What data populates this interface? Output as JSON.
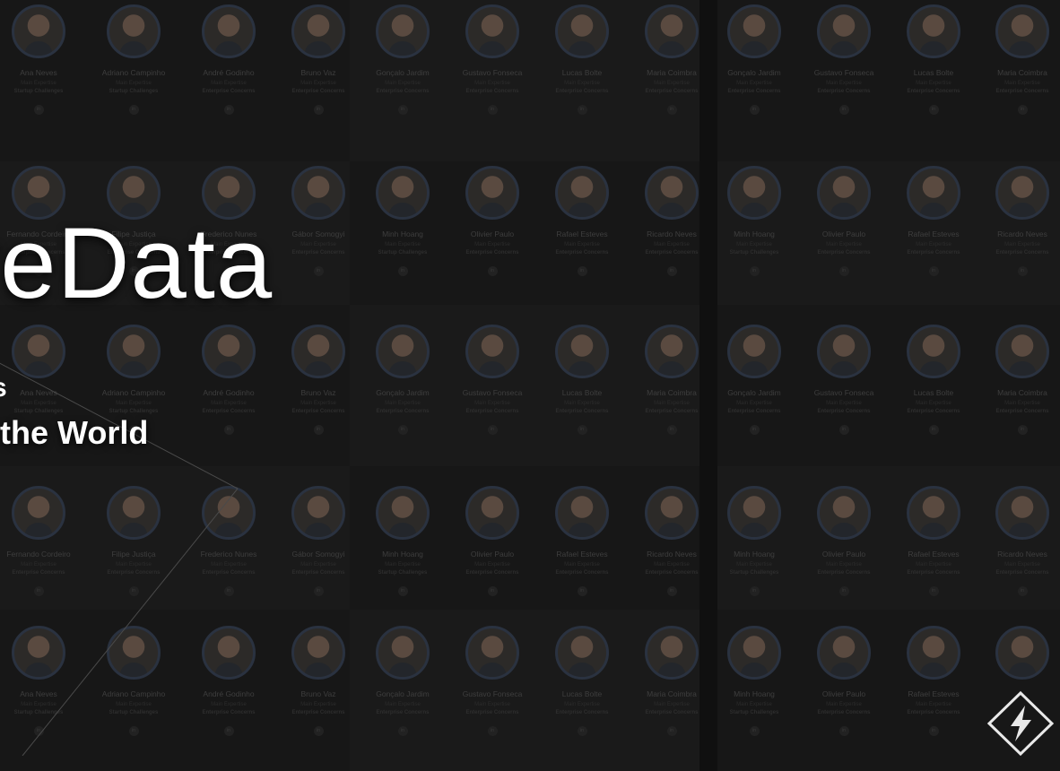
{
  "hero": {
    "title_fragment": "reData",
    "tagline_fragment_1": "s",
    "tagline_fragment_2": "the World"
  },
  "people_grid": [
    [
      {
        "name": "Ana Neves",
        "meta": "Main Expertise",
        "expertise": "Startup Challenges"
      },
      {
        "name": "Adriano Campinho",
        "meta": "Main Expertise",
        "expertise": "Startup Challenges"
      },
      {
        "name": "André Godinho",
        "meta": "Main Expertise",
        "expertise": "Enterprise Concerns"
      },
      {
        "name": "Bruno Vaz",
        "meta": "Main Expertise",
        "expertise": "Enterprise Concerns"
      },
      {
        "name": "Gonçalo Jardim",
        "meta": "Main Expertise",
        "expertise": "Enterprise Concerns"
      },
      {
        "name": "Gustavo Fonseca",
        "meta": "Main Expertise",
        "expertise": "Enterprise Concerns"
      },
      {
        "name": "Lucas Bolte",
        "meta": "Main Expertise",
        "expertise": "Enterprise Concerns"
      },
      {
        "name": "Maria Coimbra",
        "meta": "Main Expertise",
        "expertise": "Enterprise Concerns"
      },
      {
        "name": "Gonçalo Jardim",
        "meta": "Main Expertise",
        "expertise": "Enterprise Concerns"
      },
      {
        "name": "Gustavo Fonseca",
        "meta": "Main Expertise",
        "expertise": "Enterprise Concerns"
      },
      {
        "name": "Lucas Bolte",
        "meta": "Main Expertise",
        "expertise": "Enterprise Concerns"
      },
      {
        "name": "Maria Coimbra",
        "meta": "Main Expertise",
        "expertise": "Enterprise Concerns"
      }
    ],
    [
      {
        "name": "Fernando Cordeiro",
        "meta": "Main Expertise",
        "expertise": "Enterprise Concerns"
      },
      {
        "name": "Filipe Justiça",
        "meta": "Main Expertise",
        "expertise": "Enterprise Concerns"
      },
      {
        "name": "Frederico Nunes",
        "meta": "Main Expertise",
        "expertise": "Enterprise Concerns"
      },
      {
        "name": "Gábor Somogyi",
        "meta": "Main Expertise",
        "expertise": "Enterprise Concerns"
      },
      {
        "name": "Minh Hoang",
        "meta": "Main Expertise",
        "expertise": "Startup Challenges"
      },
      {
        "name": "Olivier Paulo",
        "meta": "Main Expertise",
        "expertise": "Enterprise Concerns"
      },
      {
        "name": "Rafael Esteves",
        "meta": "Main Expertise",
        "expertise": "Enterprise Concerns"
      },
      {
        "name": "Ricardo Neves",
        "meta": "Main Expertise",
        "expertise": "Enterprise Concerns"
      },
      {
        "name": "Minh Hoang",
        "meta": "Main Expertise",
        "expertise": "Startup Challenges"
      },
      {
        "name": "Olivier Paulo",
        "meta": "Main Expertise",
        "expertise": "Enterprise Concerns"
      },
      {
        "name": "Rafael Esteves",
        "meta": "Main Expertise",
        "expertise": "Enterprise Concerns"
      },
      {
        "name": "Ricardo Neves",
        "meta": "Main Expertise",
        "expertise": "Enterprise Concerns"
      }
    ],
    [
      {
        "name": "Ana Neves",
        "meta": "Main Expertise",
        "expertise": "Startup Challenges"
      },
      {
        "name": "Adriano Campinho",
        "meta": "Main Expertise",
        "expertise": "Startup Challenges"
      },
      {
        "name": "André Godinho",
        "meta": "Main Expertise",
        "expertise": "Enterprise Concerns"
      },
      {
        "name": "Bruno Vaz",
        "meta": "Main Expertise",
        "expertise": "Enterprise Concerns"
      },
      {
        "name": "Gonçalo Jardim",
        "meta": "Main Expertise",
        "expertise": "Enterprise Concerns"
      },
      {
        "name": "Gustavo Fonseca",
        "meta": "Main Expertise",
        "expertise": "Enterprise Concerns"
      },
      {
        "name": "Lucas Bolte",
        "meta": "Main Expertise",
        "expertise": "Enterprise Concerns"
      },
      {
        "name": "Maria Coimbra",
        "meta": "Main Expertise",
        "expertise": "Enterprise Concerns"
      },
      {
        "name": "Gonçalo Jardim",
        "meta": "Main Expertise",
        "expertise": "Enterprise Concerns"
      },
      {
        "name": "Gustavo Fonseca",
        "meta": "Main Expertise",
        "expertise": "Enterprise Concerns"
      },
      {
        "name": "Lucas Bolte",
        "meta": "Main Expertise",
        "expertise": "Enterprise Concerns"
      },
      {
        "name": "Maria Coimbra",
        "meta": "Main Expertise",
        "expertise": "Enterprise Concerns"
      }
    ],
    [
      {
        "name": "Fernando Cordeiro",
        "meta": "Main Expertise",
        "expertise": "Enterprise Concerns"
      },
      {
        "name": "Filipe Justiça",
        "meta": "Main Expertise",
        "expertise": "Enterprise Concerns"
      },
      {
        "name": "Frederico Nunes",
        "meta": "Main Expertise",
        "expertise": "Enterprise Concerns"
      },
      {
        "name": "Gábor Somogyi",
        "meta": "Main Expertise",
        "expertise": "Enterprise Concerns"
      },
      {
        "name": "Minh Hoang",
        "meta": "Main Expertise",
        "expertise": "Startup Challenges"
      },
      {
        "name": "Olivier Paulo",
        "meta": "Main Expertise",
        "expertise": "Enterprise Concerns"
      },
      {
        "name": "Rafael Esteves",
        "meta": "Main Expertise",
        "expertise": "Enterprise Concerns"
      },
      {
        "name": "Ricardo Neves",
        "meta": "Main Expertise",
        "expertise": "Enterprise Concerns"
      },
      {
        "name": "Minh Hoang",
        "meta": "Main Expertise",
        "expertise": "Startup Challenges"
      },
      {
        "name": "Olivier Paulo",
        "meta": "Main Expertise",
        "expertise": "Enterprise Concerns"
      },
      {
        "name": "Rafael Esteves",
        "meta": "Main Expertise",
        "expertise": "Enterprise Concerns"
      },
      {
        "name": "Ricardo Neves",
        "meta": "Main Expertise",
        "expertise": "Enterprise Concerns"
      }
    ],
    [
      {
        "name": "Ana Neves",
        "meta": "Main Expertise",
        "expertise": "Startup Challenges"
      },
      {
        "name": "Adriano Campinho",
        "meta": "Main Expertise",
        "expertise": "Startup Challenges"
      },
      {
        "name": "André Godinho",
        "meta": "Main Expertise",
        "expertise": "Enterprise Concerns"
      },
      {
        "name": "Bruno Vaz",
        "meta": "Main Expertise",
        "expertise": "Enterprise Concerns"
      },
      {
        "name": "Gonçalo Jardim",
        "meta": "Main Expertise",
        "expertise": "Enterprise Concerns"
      },
      {
        "name": "Gustavo Fonseca",
        "meta": "Main Expertise",
        "expertise": "Enterprise Concerns"
      },
      {
        "name": "Lucas Bolte",
        "meta": "Main Expertise",
        "expertise": "Enterprise Concerns"
      },
      {
        "name": "Maria Coimbra",
        "meta": "Main Expertise",
        "expertise": "Enterprise Concerns"
      },
      {
        "name": "Minh Hoang",
        "meta": "Main Expertise",
        "expertise": "Startup Challenges"
      },
      {
        "name": "Olivier Paulo",
        "meta": "Main Expertise",
        "expertise": "Enterprise Concerns"
      },
      {
        "name": "Rafael Esteves",
        "meta": "Main Expertise",
        "expertise": "Enterprise Concerns"
      },
      {
        "name": ""
      }
    ]
  ],
  "linkedin_icon_glyph": "in",
  "colors": {
    "background": "#101010",
    "title_text": "#ffffff",
    "logo_stroke": "#e9e9e9"
  },
  "icons": [
    "linkedin-icon",
    "bolt-logo-icon"
  ]
}
